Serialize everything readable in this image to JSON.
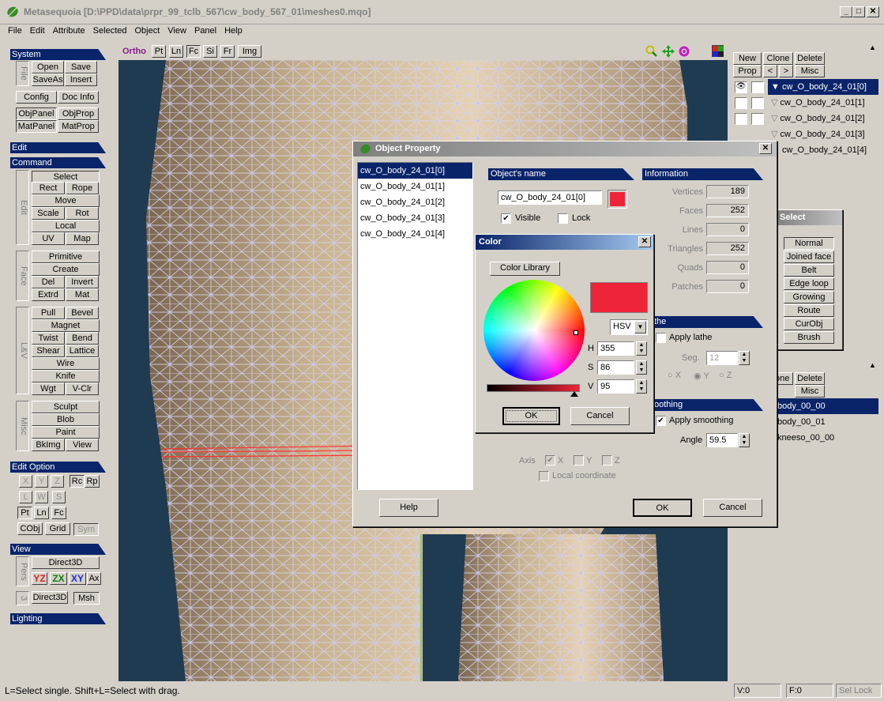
{
  "window": {
    "title": "Metasequoia [D:\\PPD\\data\\prpr_99_tclb_567\\cw_body_567_01\\meshes0.mqo]"
  },
  "menu": [
    "File",
    "Edit",
    "Attribute",
    "Selected",
    "Object",
    "View",
    "Panel",
    "Help"
  ],
  "left": {
    "system": "System",
    "file_label": "File",
    "open": "Open",
    "save": "Save",
    "saveas": "SaveAs",
    "insert": "Insert",
    "config": "Config",
    "docinfo": "Doc Info",
    "objpanel": "ObjPanel",
    "objprop": "ObjProp",
    "matpanel": "MatPanel",
    "matprop": "MatProp",
    "edit": "Edit",
    "command": "Command",
    "edit_label": "Edit",
    "select": "Select",
    "rect": "Rect",
    "rope": "Rope",
    "move": "Move",
    "scale": "Scale",
    "rot": "Rot",
    "local": "Local",
    "uv": "UV",
    "map": "Map",
    "face_label": "Face",
    "primitive": "Primitive",
    "create": "Create",
    "del": "Del",
    "invert": "Invert",
    "extrd": "Extrd",
    "mat": "Mat",
    "lv_label": "L&V",
    "pull": "Pull",
    "bevel": "Bevel",
    "magnet": "Magnet",
    "twist": "Twist",
    "bend": "Bend",
    "shear": "Shear",
    "lattice": "Lattice",
    "wire": "Wire",
    "knife": "Knife",
    "wgt": "Wgt",
    "vclr": "V-Clr",
    "misc_label": "Misc",
    "sculpt": "Sculpt",
    "blob": "Blob",
    "paint": "Paint",
    "bkimg": "BkImg",
    "view": "View",
    "editoption": "Edit Option",
    "x": "X",
    "y": "Y",
    "z": "Z",
    "rc": "Rc",
    "rp": "Rp",
    "l": "L",
    "w": "W",
    "s": "S",
    "pt": "Pt",
    "ln": "Ln",
    "fc": "Fc",
    "cobj": "CObj",
    "grid": "Grid",
    "sym": "Sym",
    "view_sec": "View",
    "pers_label": "Pers",
    "direct3d": "Direct3D",
    "yz": "YZ",
    "zx": "ZX",
    "xy": "XY",
    "ax": "Ax",
    "three_label": "3",
    "direct3d2": "Direct3D",
    "msh": "Msh",
    "lighting": "Lighting"
  },
  "viewtools": [
    "Ortho",
    "Pt",
    "Ln",
    "Fc",
    "Si",
    "Fr",
    "Img"
  ],
  "right": {
    "new": "New",
    "clone": "Clone",
    "delete": "Delete",
    "prop": "Prop",
    "prev": "<",
    "next": ">",
    "misc": "Misc",
    "objects": [
      "cw_O_body_24_01[0]",
      "cw_O_body_24_01[1]",
      "cw_O_body_24_01[2]",
      "cw_O_body_24_01[3]",
      "cw_O_body_24_01[4]"
    ],
    "mat_clone": "Clone",
    "mat_delete": "Delete",
    "mat_misc": "Misc",
    "materials": [
      "body_00_00",
      "body_00_01",
      "kneeso_00_00"
    ]
  },
  "select_panel": {
    "title": "Select",
    "items": [
      "Normal",
      "Joined face",
      "Belt",
      "Edge loop",
      "Growing",
      "Route",
      "CurObj",
      "Brush"
    ]
  },
  "objprop": {
    "title": "Object Property",
    "list": [
      "cw_O_body_24_01[0]",
      "cw_O_body_24_01[1]",
      "cw_O_body_24_01[2]",
      "cw_O_body_24_01[3]",
      "cw_O_body_24_01[4]"
    ],
    "name_hdr": "Object's name",
    "name": "cw_O_body_24_01[0]",
    "color": "#ee2439",
    "visible": "Visible",
    "lock": "Lock",
    "info_hdr": "Information",
    "info": [
      {
        "label": "Vertices",
        "value": "189"
      },
      {
        "label": "Faces",
        "value": "252"
      },
      {
        "label": "Lines",
        "value": "0"
      },
      {
        "label": "Triangles",
        "value": "252"
      },
      {
        "label": "Quads",
        "value": "0"
      },
      {
        "label": "Patches",
        "value": "0"
      }
    ],
    "lathe_hdr": "the",
    "apply_lathe": "Apply lathe",
    "seg_label": "Seg.",
    "seg": "12",
    "rx": "X",
    "ry": "Y",
    "rz": "Z",
    "smoothing_hdr": "oothing",
    "apply_smoothing": "Apply smoothing",
    "angle_label": "Angle",
    "angle": "59.5",
    "axis": "Axis",
    "ax": "X",
    "ay": "Y",
    "az": "Z",
    "local_coord": "Local coordinate",
    "help": "Help",
    "ok": "OK",
    "cancel": "Cancel"
  },
  "color_dlg": {
    "title": "Color",
    "library": "Color Library",
    "mode": "HSV",
    "h_label": "H",
    "h": "355",
    "s_label": "S",
    "s": "86",
    "v_label": "V",
    "v": "95",
    "swatch": "#ee2439",
    "ok": "OK",
    "cancel": "Cancel"
  },
  "status": {
    "hint": "L=Select single.  Shift+L=Select with drag.",
    "v": "V:0",
    "f": "F:0",
    "sellock": "Sel Lock"
  }
}
